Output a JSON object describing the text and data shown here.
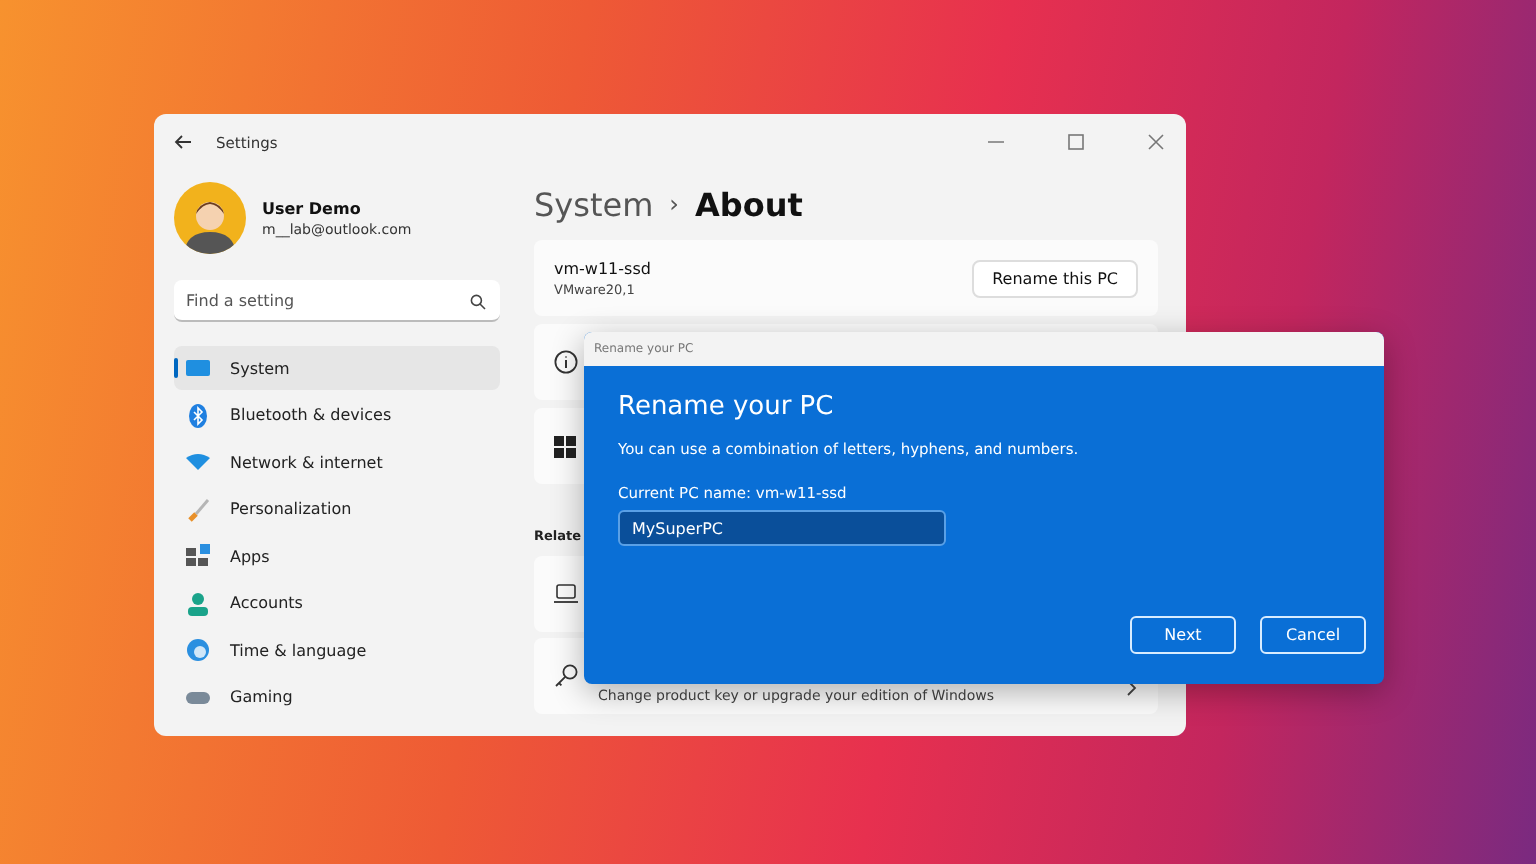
{
  "window": {
    "title": "Settings"
  },
  "profile": {
    "name": "User Demo",
    "email": "m__lab@outlook.com"
  },
  "search": {
    "placeholder": "Find a setting"
  },
  "nav": [
    {
      "label": "System",
      "kind": "system",
      "selected": true
    },
    {
      "label": "Bluetooth & devices",
      "kind": "bluetooth",
      "selected": false
    },
    {
      "label": "Network & internet",
      "kind": "network",
      "selected": false
    },
    {
      "label": "Personalization",
      "kind": "brush",
      "selected": false
    },
    {
      "label": "Apps",
      "kind": "apps",
      "selected": false
    },
    {
      "label": "Accounts",
      "kind": "accounts",
      "selected": false
    },
    {
      "label": "Time & language",
      "kind": "time",
      "selected": false
    },
    {
      "label": "Gaming",
      "kind": "gaming",
      "selected": false
    }
  ],
  "breadcrumb": {
    "parent": "System",
    "separator": "›",
    "current": "About"
  },
  "pc_card": {
    "name": "vm-w11-ssd",
    "model": "VMware20,1",
    "button": "Rename this PC"
  },
  "cards": [
    {
      "kind": "info"
    },
    {
      "kind": "windows"
    }
  ],
  "related": {
    "label": "Relate",
    "cards": [
      {
        "kind": "laptop"
      },
      {
        "kind": "key",
        "subtitle": "Change product key or upgrade your edition of Windows"
      }
    ]
  },
  "dialog": {
    "title": "Rename your PC",
    "heading": "Rename your PC",
    "description": "You can use a combination of letters, hyphens, and numbers.",
    "current_name": "Current PC name: vm-w11-ssd",
    "value": "MySuperPC",
    "buttons": [
      "Next",
      "Cancel"
    ]
  }
}
